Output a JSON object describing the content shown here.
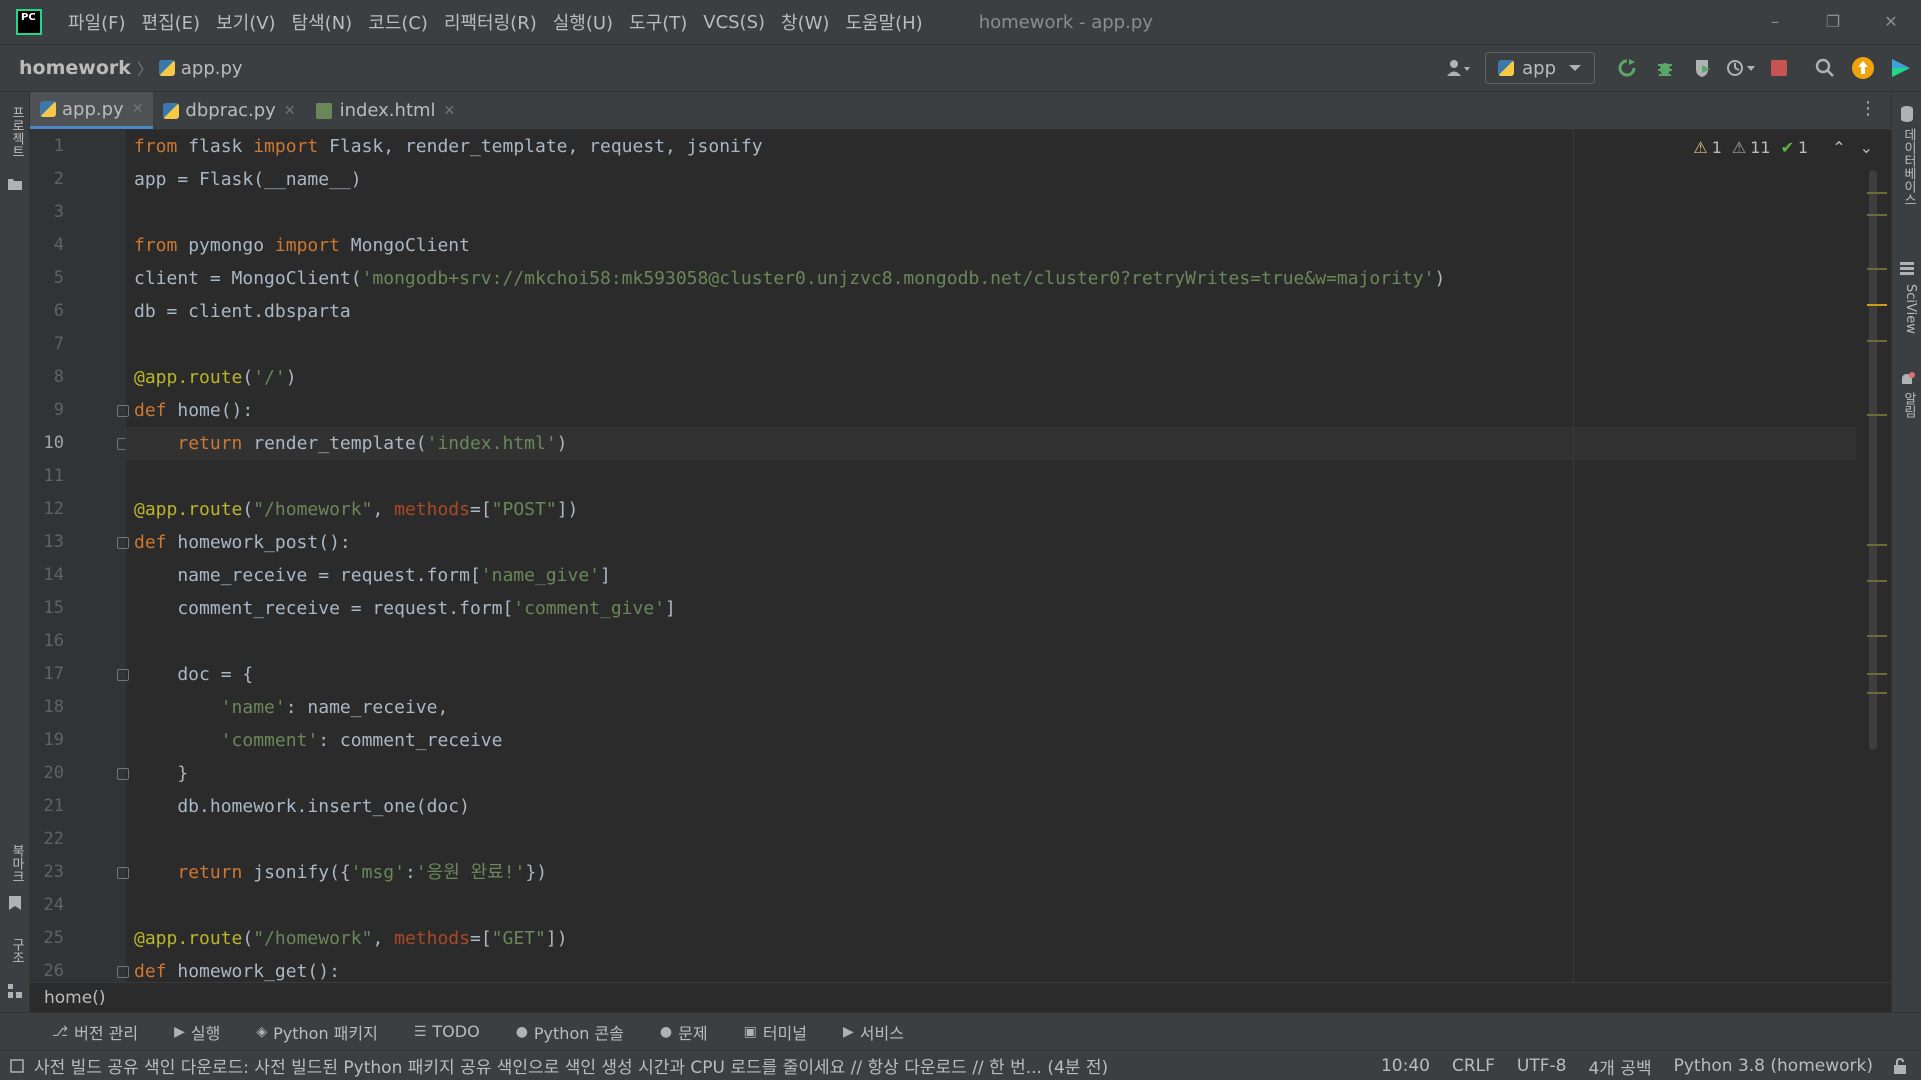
{
  "window": {
    "logo_text": "PC",
    "title": "homework - app.py",
    "menu": [
      "파일(F)",
      "편집(E)",
      "보기(V)",
      "탐색(N)",
      "코드(C)",
      "리팩터링(R)",
      "실행(U)",
      "도구(T)",
      "VCS(S)",
      "창(W)",
      "도움말(H)"
    ],
    "controls": {
      "minimize": "–",
      "restore": "❐",
      "close": "✕"
    }
  },
  "navbar": {
    "project": "homework",
    "separator": "〉",
    "file": "app.py",
    "run_config": "app",
    "icons": [
      "user-dropdown-icon",
      "rerun-icon",
      "debug-icon",
      "coverage-icon",
      "profile-icon",
      "stop-icon",
      "search-icon",
      "update-icon",
      "plugin-icon"
    ]
  },
  "left_strip": {
    "project": "프로젝트",
    "bookmarks": "북마크",
    "structure": "구조"
  },
  "right_strip": {
    "database": "데이터베이스",
    "sciview": "SciView",
    "notifications": "알림"
  },
  "tabs": [
    {
      "label": "app.py",
      "type": "py",
      "active": true
    },
    {
      "label": "dbprac.py",
      "type": "py",
      "active": false
    },
    {
      "label": "index.html",
      "type": "html",
      "active": false
    }
  ],
  "tab_menu_icon": "⋮",
  "inspections": {
    "warnings": "1",
    "weak_warnings": "11",
    "ok": "1",
    "warn_glyph": "⚠",
    "ok_glyph": "✔",
    "up": "⌃",
    "down": "⌄"
  },
  "editor": {
    "current_line": 10,
    "lines": [
      "from flask import Flask, render_template, request, jsonify",
      "app = Flask(__name__)",
      "",
      "from pymongo import MongoClient",
      "client = MongoClient('mongodb+srv://mkchoi58:mk593058@cluster0.unjzvc8.mongodb.net/cluster0?retryWrites=true&w=majority')",
      "db = client.dbsparta",
      "",
      "@app.route('/')",
      "def home():",
      "    return render_template('index.html')",
      "",
      "@app.route(\"/homework\", methods=[\"POST\"])",
      "def homework_post():",
      "    name_receive = request.form['name_give']",
      "    comment_receive = request.form['comment_give']",
      "",
      "    doc = {",
      "        'name': name_receive,",
      "        'comment': comment_receive",
      "    }",
      "    db.homework.insert_one(doc)",
      "",
      "    return jsonify({'msg':'응원 완료!'})",
      "",
      "@app.route(\"/homework\", methods=[\"GET\"])",
      "def homework_get():"
    ]
  },
  "breadcrumb": "home()",
  "tool_windows": [
    {
      "label": "버전 관리",
      "icon": "branch-icon",
      "glyph": "⎇"
    },
    {
      "label": "실행",
      "icon": "run-icon",
      "glyph": "▶"
    },
    {
      "label": "Python 패키지",
      "icon": "packages-icon",
      "glyph": "◈"
    },
    {
      "label": "TODO",
      "icon": "todo-icon",
      "glyph": "☰"
    },
    {
      "label": "Python 콘솔",
      "icon": "console-icon",
      "glyph": "●"
    },
    {
      "label": "문제",
      "icon": "problems-icon",
      "glyph": "●"
    },
    {
      "label": "터미널",
      "icon": "terminal-icon",
      "glyph": "▣"
    },
    {
      "label": "서비스",
      "icon": "services-icon",
      "glyph": "▶"
    }
  ],
  "status": {
    "message": "사전 빌드 공유 색인 다운로드: 사전 빌드된 Python 패키지 공유 색인으로 색인 생성 시간과 CPU 로드를 줄이세요 // 항상 다운로드 // 한 번... (4분 전)",
    "position": "10:40",
    "line_sep": "CRLF",
    "encoding": "UTF-8",
    "indent": "4개 공백",
    "interpreter": "Python 3.8 (homework)"
  },
  "colors": {
    "background": "#2b2b2b",
    "keyword": "#cc7832",
    "string": "#6a8759",
    "decorator": "#bbb529",
    "text": "#a9b7c6"
  }
}
